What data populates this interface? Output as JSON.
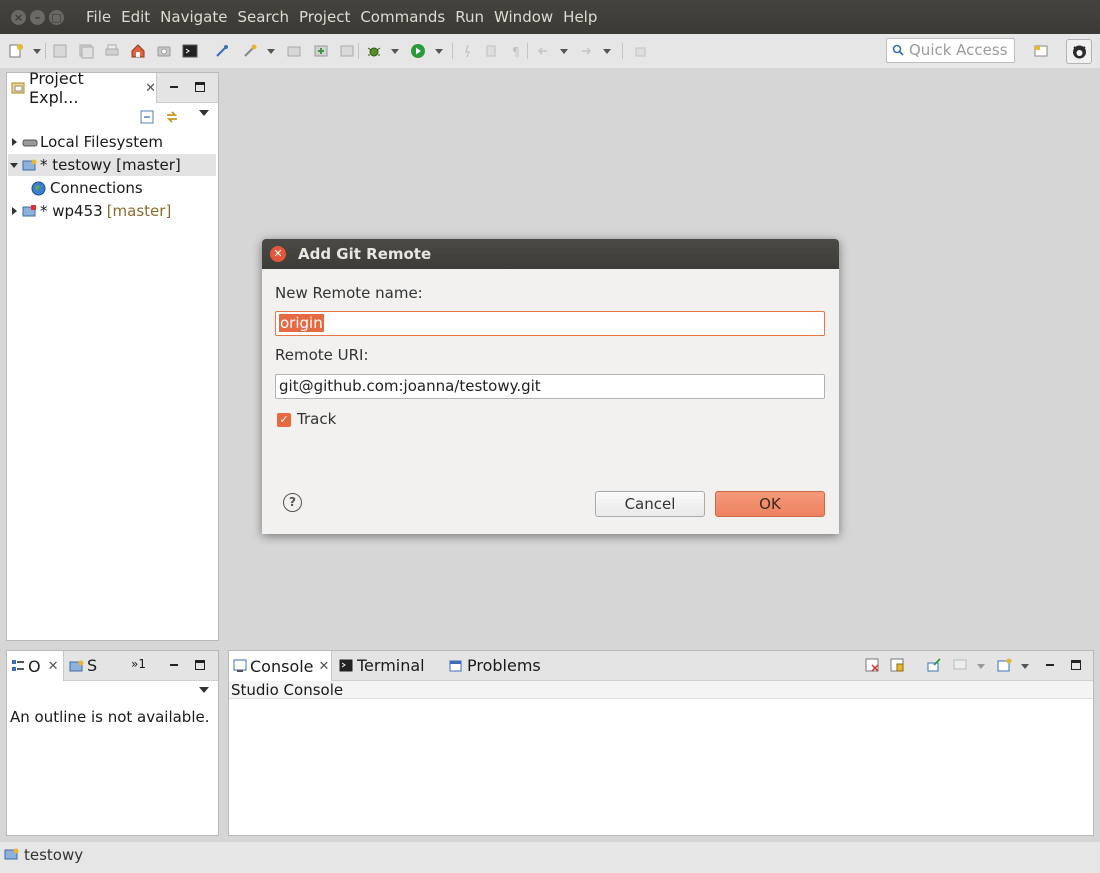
{
  "menubar": {
    "items": [
      "File",
      "Edit",
      "Navigate",
      "Search",
      "Project",
      "Commands",
      "Run",
      "Window",
      "Help"
    ]
  },
  "toolbar": {
    "quick_access_placeholder": "Quick Access"
  },
  "project_explorer": {
    "tab_label": "Project Expl...",
    "tree": [
      {
        "label": "Local Filesystem",
        "expanded": false,
        "icon": "drive-icon"
      },
      {
        "label": "* testowy [master]",
        "expanded": true,
        "icon": "git-project-icon",
        "selected": true
      },
      {
        "label": "Connections",
        "icon": "globe-icon",
        "child": true
      },
      {
        "label": "* wp453",
        "tag": "[master]",
        "expanded": false,
        "icon": "git-project-icon"
      }
    ]
  },
  "outline_panel": {
    "tab_outline": "O",
    "tab_s": "S",
    "tab_more": "»1",
    "message": "An outline is not available."
  },
  "console_panel": {
    "tabs": [
      "Console",
      "Terminal",
      "Problems"
    ],
    "title": "Studio Console"
  },
  "dialog": {
    "title": "Add Git Remote",
    "name_label": "New Remote name:",
    "name_value": "origin",
    "uri_label": "Remote URI:",
    "uri_value": "git@github.com:joanna/testowy.git",
    "track_label": "Track",
    "track_checked": true,
    "cancel_label": "Cancel",
    "ok_label": "OK"
  },
  "status_bar": {
    "text": "testowy"
  },
  "colors": {
    "accent": "#e66a41",
    "titlebar": "#3d3c38",
    "window_bg": "#d6d6d6"
  }
}
